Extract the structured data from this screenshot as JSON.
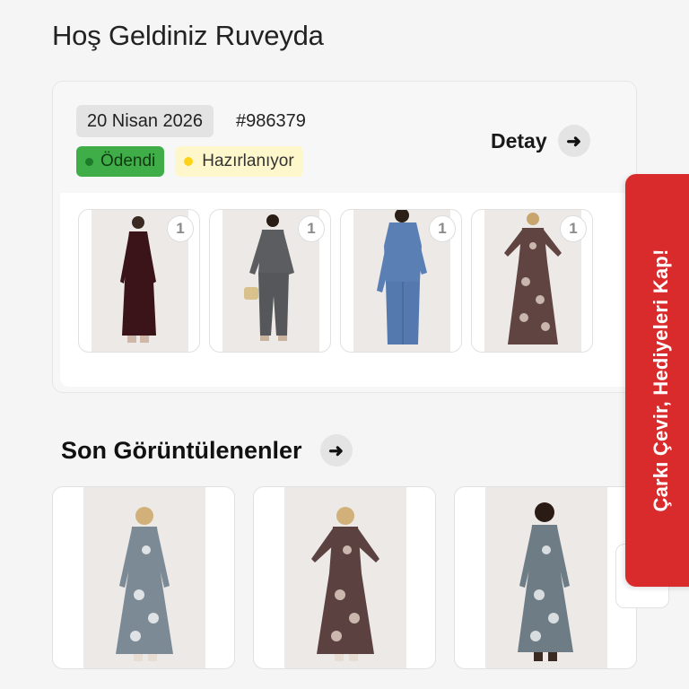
{
  "welcome": {
    "text": "Hoş Geldiniz Ruveyda"
  },
  "order": {
    "date": "20 Nisan 2026",
    "number": "#986379",
    "payment_status": "Ödendi",
    "fulfillment_status": "Hazırlanıyor",
    "detail_label": "Detay",
    "items": [
      {
        "qty": "1",
        "image": "burgundy-dress"
      },
      {
        "qty": "1",
        "image": "grey-suit"
      },
      {
        "qty": "1",
        "image": "blue-dress"
      },
      {
        "qty": "1",
        "image": "paisley-dress"
      }
    ]
  },
  "recent": {
    "title": "Son Görüntülenenler",
    "items": [
      {
        "image": "grey-paisley-dress"
      },
      {
        "image": "brown-paisley-dress"
      },
      {
        "image": "grey-paisley-dress-2"
      }
    ]
  },
  "promo": {
    "text": "Çarkı Çevir, Hediyeleri Kap!"
  },
  "colors": {
    "promo_red": "#d92b2b",
    "paid_green": "#3fae48",
    "preparing_yellow": "#ffd21a"
  }
}
